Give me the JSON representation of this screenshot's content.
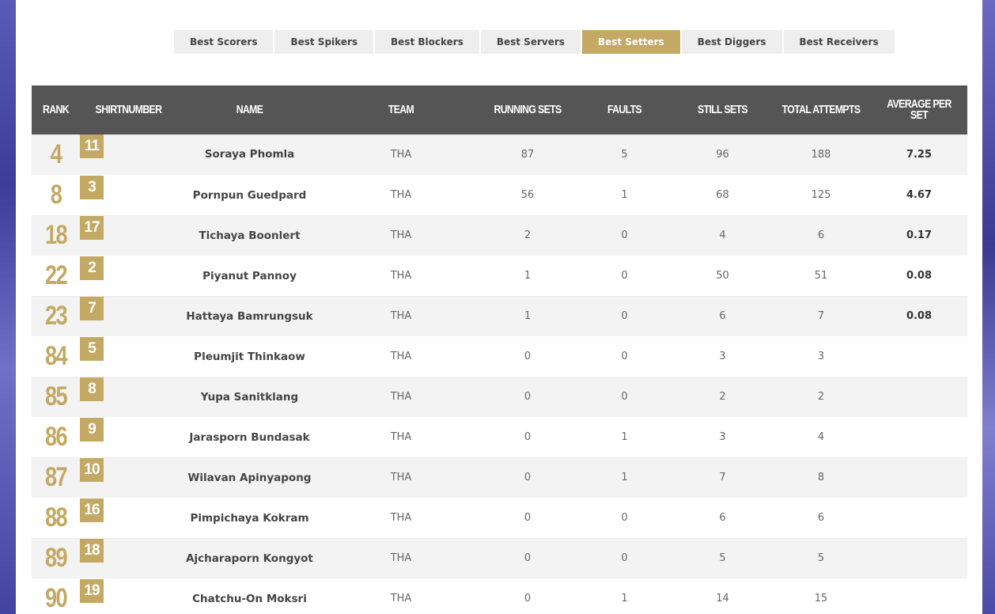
{
  "tabs": [
    {
      "label": "Best Scorers",
      "active": false
    },
    {
      "label": "Best Spikers",
      "active": false
    },
    {
      "label": "Best Blockers",
      "active": false
    },
    {
      "label": "Best Servers",
      "active": false
    },
    {
      "label": "Best Setters",
      "active": true
    },
    {
      "label": "Best Diggers",
      "active": false
    },
    {
      "label": "Best Receivers",
      "active": false
    }
  ],
  "columns": [
    "RANK",
    "SHIRTNUMBER",
    "NAME",
    "TEAM",
    "RUNNING SETS",
    "FAULTS",
    "STILL SETS",
    "TOTAL ATTEMPTS",
    "AVERAGE PER SET"
  ],
  "rows": [
    {
      "rank": "4",
      "shirt": "11",
      "name": "Soraya Phomla",
      "team": "THA",
      "running": "87",
      "faults": "5",
      "still": "96",
      "total": "188",
      "avg": "7.25"
    },
    {
      "rank": "8",
      "shirt": "3",
      "name": "Pornpun Guedpard",
      "team": "THA",
      "running": "56",
      "faults": "1",
      "still": "68",
      "total": "125",
      "avg": "4.67"
    },
    {
      "rank": "18",
      "shirt": "17",
      "name": "Tichaya Boonlert",
      "team": "THA",
      "running": "2",
      "faults": "0",
      "still": "4",
      "total": "6",
      "avg": "0.17"
    },
    {
      "rank": "22",
      "shirt": "2",
      "name": "Piyanut Pannoy",
      "team": "THA",
      "running": "1",
      "faults": "0",
      "still": "50",
      "total": "51",
      "avg": "0.08"
    },
    {
      "rank": "23",
      "shirt": "7",
      "name": "Hattaya Bamrungsuk",
      "team": "THA",
      "running": "1",
      "faults": "0",
      "still": "6",
      "total": "7",
      "avg": "0.08"
    },
    {
      "rank": "84",
      "shirt": "5",
      "name": "Pleumjit Thinkaow",
      "team": "THA",
      "running": "0",
      "faults": "0",
      "still": "3",
      "total": "3",
      "avg": ""
    },
    {
      "rank": "85",
      "shirt": "8",
      "name": "Yupa Sanitklang",
      "team": "THA",
      "running": "0",
      "faults": "0",
      "still": "2",
      "total": "2",
      "avg": ""
    },
    {
      "rank": "86",
      "shirt": "9",
      "name": "Jarasporn Bundasak",
      "team": "THA",
      "running": "0",
      "faults": "1",
      "still": "3",
      "total": "4",
      "avg": ""
    },
    {
      "rank": "87",
      "shirt": "10",
      "name": "Wilavan Apinyapong",
      "team": "THA",
      "running": "0",
      "faults": "1",
      "still": "7",
      "total": "8",
      "avg": ""
    },
    {
      "rank": "88",
      "shirt": "16",
      "name": "Pimpichaya Kokram",
      "team": "THA",
      "running": "0",
      "faults": "0",
      "still": "6",
      "total": "6",
      "avg": ""
    },
    {
      "rank": "89",
      "shirt": "18",
      "name": "Ajcharaporn Kongyot",
      "team": "THA",
      "running": "0",
      "faults": "0",
      "still": "5",
      "total": "5",
      "avg": ""
    },
    {
      "rank": "90",
      "shirt": "19",
      "name": "Chatchu-On Moksri",
      "team": "THA",
      "running": "0",
      "faults": "1",
      "still": "14",
      "total": "15",
      "avg": ""
    }
  ],
  "colors": {
    "accent": "#c4a965",
    "header": "#555555"
  }
}
